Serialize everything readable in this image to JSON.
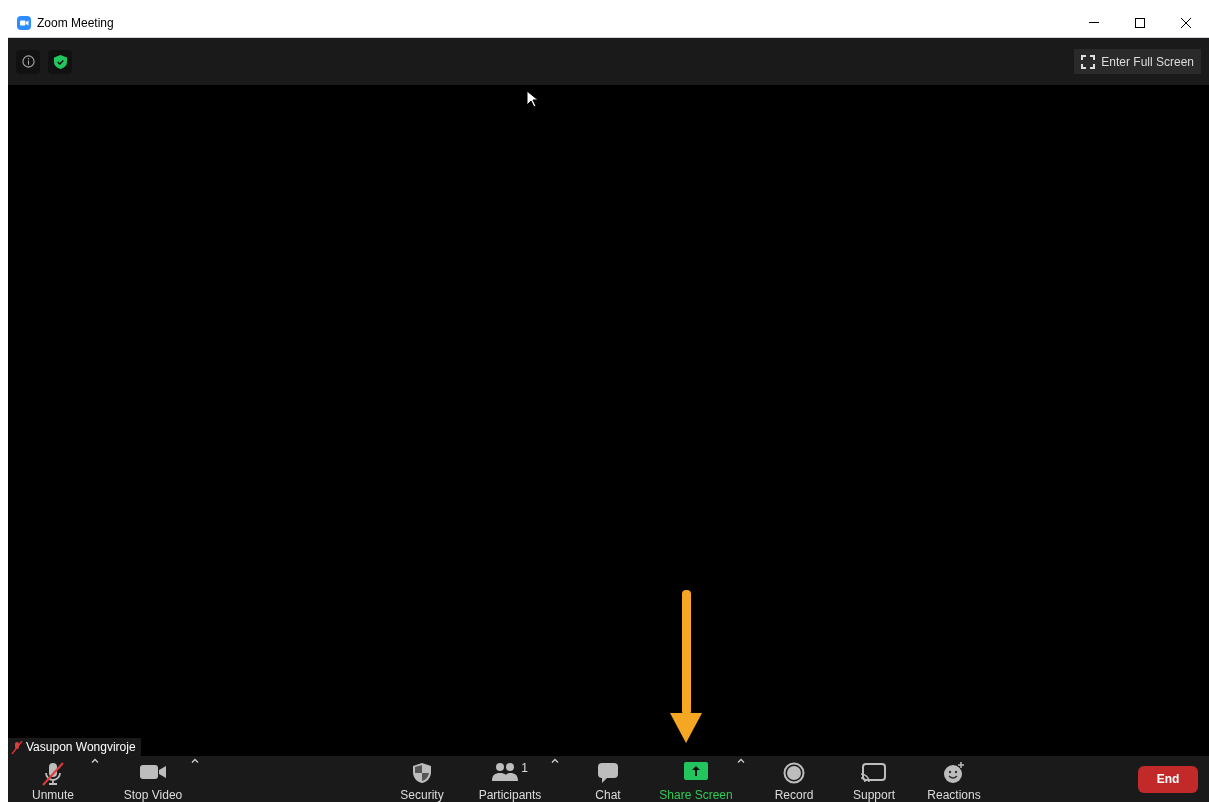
{
  "window": {
    "title": "Zoom Meeting"
  },
  "top_bar": {
    "fullscreen_button": "Enter Full Screen"
  },
  "video": {
    "participant_name": "Vasupon Wongviroje",
    "muted": true
  },
  "left_controls": [
    {
      "label": "Unmute",
      "muted": true,
      "has_menu": true
    },
    {
      "label": "Stop Video",
      "has_menu": true
    }
  ],
  "center_controls": [
    {
      "label": "Security",
      "has_menu": false,
      "highlighted": false
    },
    {
      "label": "Participants",
      "count": "1",
      "has_menu": true,
      "highlighted": false
    },
    {
      "label": "Chat",
      "has_menu": false,
      "highlighted": false
    },
    {
      "label": "Share Screen",
      "has_menu": true,
      "highlighted": true
    },
    {
      "label": "Record",
      "has_menu": false,
      "highlighted": false
    },
    {
      "label": "Support",
      "has_menu": false,
      "highlighted": false
    },
    {
      "label": "Reactions",
      "has_menu": false,
      "highlighted": false
    }
  ],
  "end_button": "End"
}
